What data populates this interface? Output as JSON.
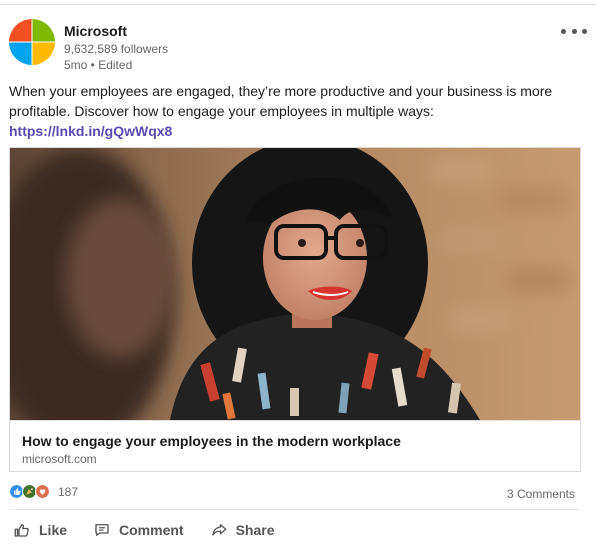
{
  "post": {
    "author": {
      "name": "Microsoft",
      "followers": "9,632,589 followers",
      "time": "5mo • Edited",
      "logo": "microsoft-logo",
      "logo_colors": [
        "#f25022",
        "#7fba00",
        "#00a4ef",
        "#ffb900"
      ]
    },
    "text": "When your employees are engaged, they’re more productive and your business is more profitable. Discover how to engage your employees in multiple ways:",
    "link": "https://lnkd.in/gQwWqx8",
    "more_icon": "more-horizontal-icon"
  },
  "article": {
    "title": "How to engage your employees in the modern workplace",
    "domain": "microsoft.com",
    "image": "photo-smiling-woman-with-glasses"
  },
  "social": {
    "reaction_icons": [
      "like-icon",
      "celebrate-icon",
      "love-icon"
    ],
    "reaction_count": "187",
    "comments": "3 Comments"
  },
  "actions": {
    "like": "Like",
    "comment": "Comment",
    "share": "Share"
  },
  "colors": {
    "link": "#5b4ab0",
    "like_blue": "#378fe9",
    "celebrate_green": "#44712e",
    "love_red": "#df704d"
  }
}
